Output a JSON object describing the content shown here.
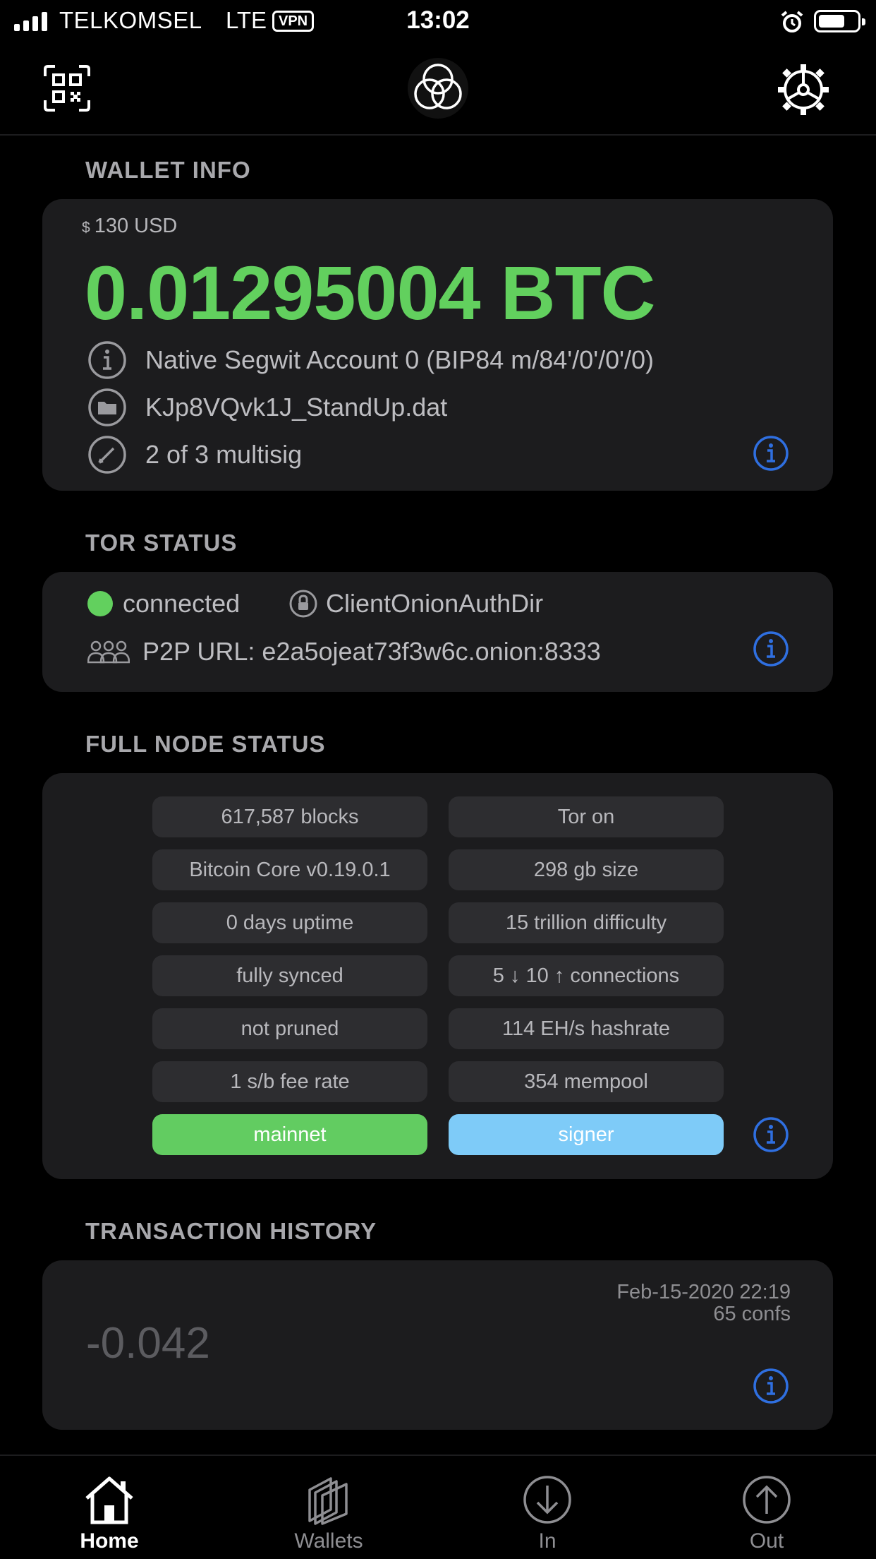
{
  "status_bar": {
    "carrier": "TELKOMSEL",
    "network": "LTE",
    "vpn": "VPN",
    "time": "13:02"
  },
  "nav": {
    "qr_icon": "qr-code-icon",
    "logo_icon": "fully-noded-logo-icon",
    "settings_icon": "gear-icon"
  },
  "wallet_info": {
    "section_title": "WALLET INFO",
    "currency_symbol": "$",
    "fiat_balance": "130 USD",
    "btc_balance": "0.01295004 BTC",
    "account": "Native Segwit Account 0 (BIP84 m/84'/0'/0'/0)",
    "file": "KJp8VQvk1J_StandUp.dat",
    "type": "2 of 3 multisig"
  },
  "tor_status": {
    "section_title": "TOR STATUS",
    "status": "connected",
    "auth": "ClientOnionAuthDir",
    "p2p_url": "P2P URL: e2a5ojeat73f3w6c.onion:8333"
  },
  "full_node_status": {
    "section_title": "FULL NODE STATUS",
    "left": [
      "617,587 blocks",
      "Bitcoin Core v0.19.0.1",
      "0 days uptime",
      "fully synced",
      "not pruned",
      "1 s/b fee rate"
    ],
    "right": [
      "Tor on",
      "298 gb size",
      "15 trillion difficulty",
      "5 ↓ 10 ↑ connections",
      "114 EH/s hashrate",
      "354 mempool"
    ],
    "network": "mainnet",
    "role": "signer"
  },
  "transaction_history": {
    "section_title": "TRANSACTION HISTORY",
    "items": [
      {
        "amount": "-0.042",
        "date": "Feb-15-2020 22:19",
        "confs": "65 confs"
      }
    ]
  },
  "tabs": [
    {
      "label": "Home",
      "icon": "home-icon",
      "active": true
    },
    {
      "label": "Wallets",
      "icon": "wallets-icon",
      "active": false
    },
    {
      "label": "In",
      "icon": "arrow-down-circle-icon",
      "active": false
    },
    {
      "label": "Out",
      "icon": "arrow-up-circle-icon",
      "active": false
    }
  ],
  "colors": {
    "balance_green": "#62d05e",
    "info_blue": "#2f6fe0",
    "mainnet_green": "#62cc61",
    "signer_blue": "#7ecbf8",
    "card_bg": "#1c1c1e"
  }
}
